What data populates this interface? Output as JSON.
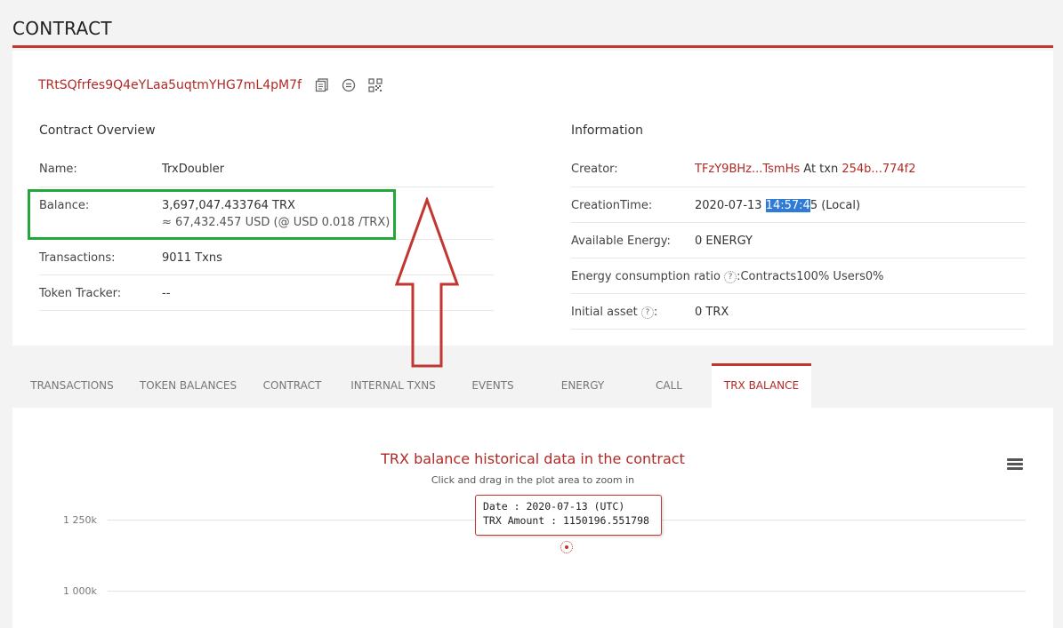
{
  "page": {
    "title": "CONTRACT"
  },
  "contract": {
    "address": "TRtSQfrfes9Q4eYLaa5uqtmYHG7mL4pM7f"
  },
  "overview": {
    "title": "Contract Overview",
    "name_label": "Name:",
    "name_value": "TrxDoubler",
    "balance_label": "Balance:",
    "balance_trx": "3,697,047.433764 TRX",
    "balance_usd": "≈ 67,432.457 USD (@ USD 0.018 /TRX)",
    "transactions_label": "Transactions:",
    "transactions_value": "9011  Txns",
    "token_label": "Token Tracker:",
    "token_value": "--"
  },
  "info": {
    "title": "Information",
    "creator_label": "Creator:",
    "creator_addr": "TFzY9BHz...TsmHs",
    "creator_at": " At txn ",
    "creator_txn": "254b...774f2",
    "creation_label": "CreationTime:",
    "creation_date": "2020-07-13 ",
    "creation_time_hl": "14:57:4",
    "creation_time_rest": "5 (Local)",
    "energy_label": "Available Energy:",
    "energy_value": "0  ENERGY",
    "ratio_label": "Energy consumption ratio",
    "ratio_value": ":Contracts100%  Users0%",
    "initial_label": "Initial asset",
    "initial_colon": ":",
    "initial_value": "0 TRX",
    "help_glyph": "?"
  },
  "tabs": [
    {
      "label": "TRANSACTIONS"
    },
    {
      "label": "TOKEN BALANCES"
    },
    {
      "label": "CONTRACT"
    },
    {
      "label": "INTERNAL TXNS"
    },
    {
      "label": "EVENTS"
    },
    {
      "label": "ENERGY"
    },
    {
      "label": "CALL"
    },
    {
      "label": "TRX BALANCE",
      "active": true
    }
  ],
  "chart": {
    "title": "TRX balance historical data in the contract",
    "subtitle": "Click and drag in the plot area to zoom in",
    "tick_1250": "1 250k",
    "tick_1000": "1 000k",
    "tooltip_date": "Date : 2020-07-13 (UTC)",
    "tooltip_amount": "TRX Amount : 1150196.551798"
  },
  "chart_data": {
    "type": "line",
    "title": "TRX balance historical data in the contract",
    "subtitle": "Click and drag in the plot area to zoom in",
    "x": [
      "2020-07-13"
    ],
    "series": [
      {
        "values": [
          1150196.551798
        ]
      }
    ],
    "yticks": [
      "1 250k",
      "1 000k"
    ],
    "grid": true
  },
  "colors": {
    "accent": "#c23631",
    "highlight_box": "#22a83a",
    "link": "#b02a25"
  }
}
